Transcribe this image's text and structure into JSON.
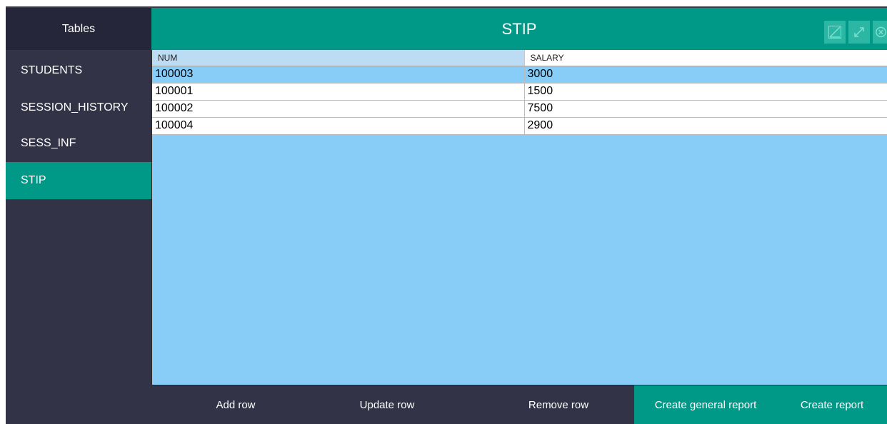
{
  "sidebar": {
    "header": "Tables",
    "items": [
      {
        "label": "STUDENTS",
        "active": false
      },
      {
        "label": "SESSION_HISTORY",
        "active": false
      },
      {
        "label": "SESS_INF",
        "active": false
      },
      {
        "label": "STIP",
        "active": true
      }
    ]
  },
  "header": {
    "title": "STIP",
    "window_buttons": [
      "minimize-icon",
      "maximize-icon",
      "close-icon"
    ]
  },
  "table": {
    "columns": [
      "NUM",
      "SALARY"
    ],
    "rows": [
      {
        "num": "100003",
        "salary": "3000",
        "selected": true
      },
      {
        "num": "100001",
        "salary": "1500",
        "selected": false
      },
      {
        "num": "100002",
        "salary": "7500",
        "selected": false
      },
      {
        "num": "100004",
        "salary": "2900",
        "selected": false
      }
    ]
  },
  "footer": {
    "add": "Add row",
    "update": "Update row",
    "remove": "Remove row",
    "general_report": "Create general report",
    "report": "Create report"
  },
  "colors": {
    "accent": "#009886",
    "sidebar_bg": "#333347",
    "sidebar_header_bg": "#26263a",
    "grid_bg": "#87cdf8"
  }
}
